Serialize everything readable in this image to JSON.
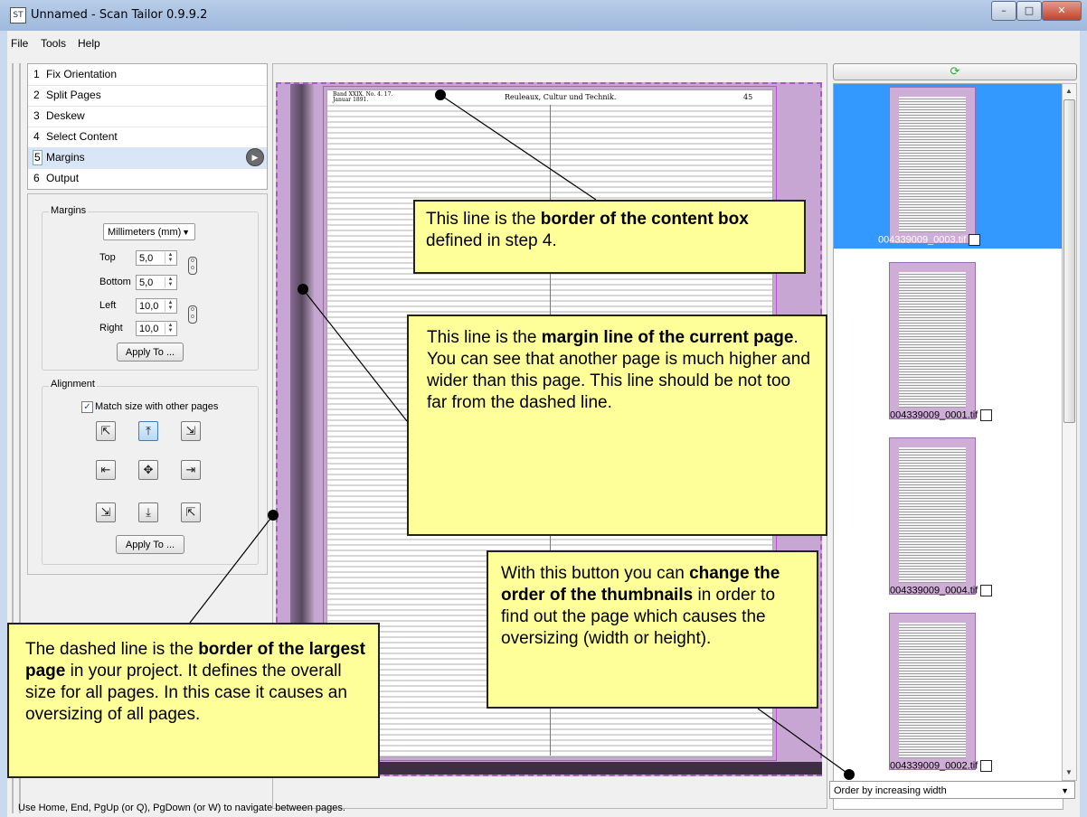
{
  "window": {
    "title": "Unnamed - Scan Tailor 0.9.9.2",
    "app_icon": "ST",
    "controls": {
      "minimize": "–",
      "maximize": "□",
      "close": "✕"
    }
  },
  "menu": [
    "File",
    "Tools",
    "Help"
  ],
  "steps": [
    {
      "num": "1",
      "label": "Fix Orientation"
    },
    {
      "num": "2",
      "label": "Split Pages"
    },
    {
      "num": "3",
      "label": "Deskew"
    },
    {
      "num": "4",
      "label": "Select Content"
    },
    {
      "num": "5",
      "label": "Margins",
      "selected": true
    },
    {
      "num": "6",
      "label": "Output"
    }
  ],
  "margins": {
    "group_title": "Margins",
    "units": "Millimeters (mm)",
    "top_label": "Top",
    "top": "5,0",
    "bottom_label": "Bottom",
    "bottom": "5,0",
    "left_label": "Left",
    "left": "10,0",
    "right_label": "Right",
    "right": "10,0",
    "apply": "Apply To ..."
  },
  "alignment": {
    "group_title": "Alignment",
    "match_size": "Match size with other pages",
    "match_checked": true,
    "apply": "Apply To ..."
  },
  "page": {
    "header_left": "Band XXIX. No. 4. 17. Januar 1891.",
    "header_center": "Reuleaux, Cultur und Technik.",
    "header_right": "45"
  },
  "callouts": {
    "c1": {
      "pre": "This line is the ",
      "bold": "border of the content box",
      "post": " defined in step 4."
    },
    "c2": {
      "pre": "This line is the ",
      "bold": "margin line of the current page",
      "post": ".",
      "extra": "You can see that another page is much higher and wider than this page. This line should be not too far from the dashed line."
    },
    "c3": {
      "pre": "With this button you can ",
      "bold": "change the order of the thumbnails",
      "post": " in order to find out the page which causes the oversizing (width or height)."
    },
    "c4": {
      "pre": "The dashed line is the ",
      "bold": "border of the largest page",
      "post": " in your project. It defines the overall size for all pages. In this case it causes an oversizing of all pages."
    }
  },
  "thumbnails": [
    {
      "caption": "004339009_0003.tif",
      "selected": true
    },
    {
      "caption": "004339009_0001.tif",
      "selected": false
    },
    {
      "caption": "004339009_0004.tif",
      "selected": false
    },
    {
      "caption": "004339009_0002.tif",
      "selected": false
    }
  ],
  "sort": {
    "order": "Order by increasing width"
  },
  "status": "Use Home, End, PgUp (or Q), PgDown (or W) to navigate between pages.",
  "icons": {
    "refresh": "refresh-icon",
    "run": "play-icon",
    "chain": "chain-link-icon"
  }
}
